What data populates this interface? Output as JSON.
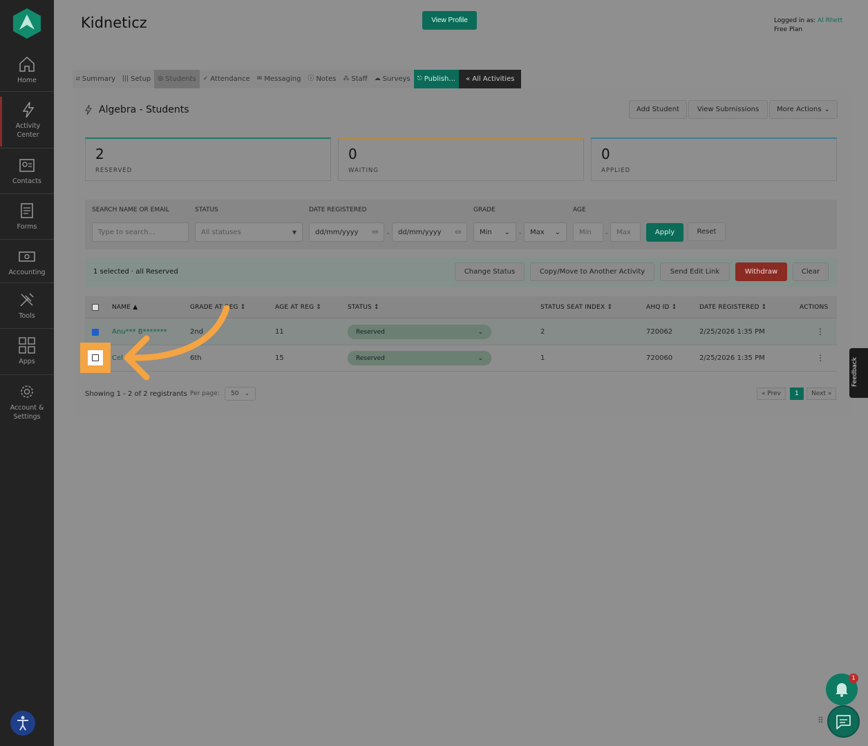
{
  "sidebar": {
    "items": [
      {
        "label": "Home",
        "icon": "home-icon"
      },
      {
        "label": "Activity\nCenter",
        "icon": "lightning-icon"
      },
      {
        "label": "Contacts",
        "icon": "contacts-icon"
      },
      {
        "label": "Forms",
        "icon": "forms-icon"
      },
      {
        "label": "Accounting",
        "icon": "accounting-icon"
      },
      {
        "label": "Tools",
        "icon": "tools-icon"
      },
      {
        "label": "Apps",
        "icon": "apps-icon"
      },
      {
        "label": "Account &\nSettings",
        "icon": "gear-icon"
      }
    ]
  },
  "header": {
    "title": "Kidneticz",
    "view_profile": "View Profile",
    "logged_in_label": "Logged in as:",
    "user": "Al Rhett",
    "plan": "Free Plan"
  },
  "tabs": [
    {
      "label": "Summary",
      "icon": "⧄"
    },
    {
      "label": "Setup",
      "icon": "|||"
    },
    {
      "label": "Students",
      "icon": "◎"
    },
    {
      "label": "Attendance",
      "icon": "✓"
    },
    {
      "label": "Messaging",
      "icon": "✉"
    },
    {
      "label": "Notes",
      "icon": "ⓘ"
    },
    {
      "label": "Staff",
      "icon": "⁂"
    },
    {
      "label": "Surveys",
      "icon": "☁"
    },
    {
      "label": "Publish...",
      "icon": "⎋"
    },
    {
      "label": "« All Activities",
      "icon": ""
    }
  ],
  "panel": {
    "title": "Algebra - Students",
    "add_student": "Add Student",
    "view_submissions": "View Submissions",
    "more_actions": "More Actions"
  },
  "cards": [
    {
      "value": "2",
      "label": "RESERVED",
      "color": "#1a7a65"
    },
    {
      "value": "0",
      "label": "WAITING",
      "color": "#b98a3a"
    },
    {
      "value": "0",
      "label": "APPLIED",
      "color": "#3a7f9a"
    }
  ],
  "filters": {
    "search_label": "SEARCH NAME OR EMAIL",
    "search_placeholder": "Type to search...",
    "status_label": "STATUS",
    "status_value": "All statuses",
    "date_label": "DATE REGISTERED",
    "date_from": "dd/mm/yyyy",
    "date_to": "dd/mm/yyyy",
    "grade_label": "GRADE",
    "grade_min": "Min",
    "grade_max": "Max",
    "age_label": "AGE",
    "age_min": "Min",
    "age_max": "Max",
    "apply": "Apply",
    "reset": "Reset"
  },
  "selection": {
    "text": "1 selected · all Reserved",
    "change_status": "Change Status",
    "copy_move": "Copy/Move to Another Activity",
    "send_edit_link": "Send Edit Link",
    "withdraw": "Withdraw",
    "clear": "Clear"
  },
  "table": {
    "headers": {
      "name": "NAME ▲",
      "grade": "GRADE AT REG ↕",
      "age": "AGE AT REG ↕",
      "status": "STATUS ↕",
      "seat": "STATUS SEAT INDEX ↕",
      "ahq": "AHQ ID ↕",
      "date": "DATE REGISTERED ↕",
      "actions": "ACTIONS"
    },
    "rows": [
      {
        "name": "Anu*** B*******",
        "grade": "2nd",
        "age": "11",
        "status": "Reserved",
        "seat": "2",
        "ahq": "720062",
        "date": "2/25/2026 1:35 PM",
        "checked": true
      },
      {
        "name": "Cel",
        "grade": "6th",
        "age": "15",
        "status": "Reserved",
        "seat": "1",
        "ahq": "720060",
        "date": "2/25/2026 1:35 PM",
        "checked": false
      }
    ]
  },
  "footer": {
    "showing": "Showing 1 - 2 of 2 registrants",
    "per_page_label": "Per page:",
    "per_page": "50",
    "prev": "« Prev",
    "page": "1",
    "next": "Next »"
  },
  "widgets": {
    "feedback": "Feedback",
    "notification_count": "1"
  }
}
